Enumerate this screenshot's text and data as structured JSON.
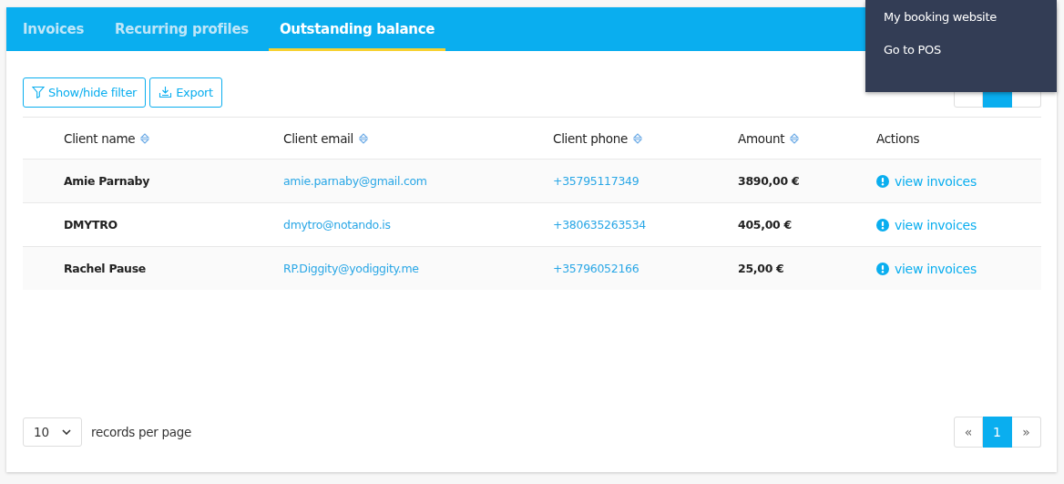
{
  "tabs": [
    {
      "label": "Invoices",
      "selected": false
    },
    {
      "label": "Recurring profiles",
      "selected": false
    },
    {
      "label": "Outstanding balance",
      "selected": true
    }
  ],
  "toolbar": {
    "buttons": [
      {
        "label": "Show/hide filter",
        "kind": "filter"
      },
      {
        "label": "Export",
        "kind": "export"
      }
    ]
  },
  "pagination_top": {
    "pages": [
      {
        "selected": true
      }
    ]
  },
  "table": {
    "columns": [
      {
        "label": "Client name",
        "sortable": true
      },
      {
        "label": "Client email",
        "sortable": true
      },
      {
        "label": "Client phone",
        "sortable": true
      },
      {
        "label": "Amount",
        "sortable": true
      },
      {
        "label": "Actions",
        "sortable": false
      }
    ],
    "rows": [
      {
        "name": "Amie Parnaby",
        "email": "amie.parnaby@gmail.com",
        "phone": "+35795117349",
        "amount": "3890,00 €",
        "action": "view invoices"
      },
      {
        "name": "DMYTRO",
        "email": "dmytro@notando.is",
        "phone": "+380635263534",
        "amount": "405,00 €",
        "action": "view invoices"
      },
      {
        "name": "Rachel Pause",
        "email": "RP.Diggity@yodiggity.me",
        "phone": "+35796052166",
        "amount": "25,00 €",
        "action": "view invoices"
      }
    ]
  },
  "footer": {
    "page_size": "10",
    "page_size_label": "records per page"
  },
  "pagination_bottom": {
    "first": "«",
    "pages": [
      {
        "label": "1",
        "selected": true
      }
    ],
    "last": "»"
  },
  "menu": {
    "items": [
      "My booking website",
      "Go to POS"
    ]
  }
}
